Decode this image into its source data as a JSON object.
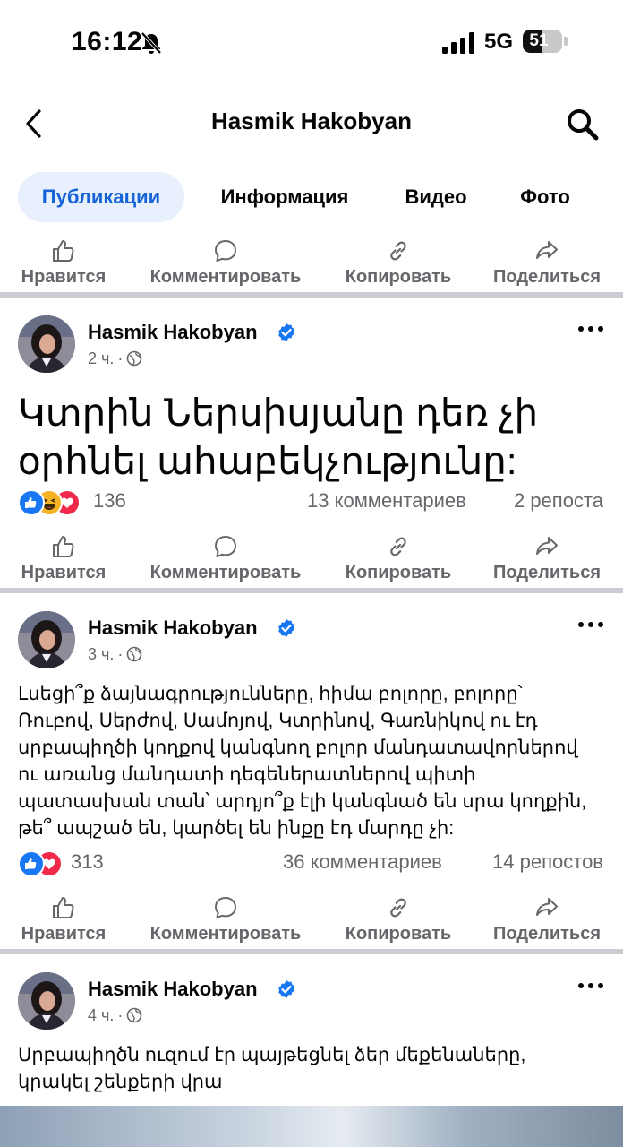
{
  "status_bar": {
    "time": "16:12",
    "network": "5G",
    "battery": "51",
    "battery_level": 0.51
  },
  "nav": {
    "title": "Hasmik Hakobyan"
  },
  "tabs": [
    {
      "label": "Публикации",
      "active": true
    },
    {
      "label": "Информация",
      "active": false
    },
    {
      "label": "Видео",
      "active": false
    },
    {
      "label": "Фото",
      "active": false
    }
  ],
  "actions": {
    "like": "Нравится",
    "comment": "Комментировать",
    "copy": "Копировать",
    "share": "Поделиться"
  },
  "posts": [
    {
      "author": "Hasmik Hakobyan",
      "time": "2 ч.",
      "text": "Կտրին Ներսիսյանը դեռ չի օրհնել ահաբեկչությունը:",
      "reactions": [
        "like",
        "haha",
        "love"
      ],
      "reaction_count": "136",
      "comments": "13 комментариев",
      "reposts": "2 репоста"
    },
    {
      "author": "Hasmik Hakobyan",
      "time": "3 ч.",
      "text_lines": [
        "Լսեցի՞ք ձայնագրությունները, հիմա բոլորը, բոլորը՝",
        "Ռուբով, Սերժով, Սամոյով, Կտրինով, Գառնիկով ու էդ",
        "սրբապիղծի կողքով կանգնող բոլոր մանդատավորներով",
        "ու առանց մանդատի դեգեներատներով պիտի",
        "պատասխան տան՝ արդյո՞ք էլի կանգնած են սրա կողքին,",
        "թե՞ ապշած են, կարծել են ինքը էդ մարդը չի:"
      ],
      "reactions": [
        "like",
        "love"
      ],
      "reaction_count": "313",
      "comments": "36 комментариев",
      "reposts": "14 репостов"
    },
    {
      "author": "Hasmik Hakobyan",
      "time": "4 ч.",
      "text_lines": [
        "Սրբապիղծն ուզում էր պայթեցնել ձեր մեքենաները,",
        "կրակել շենքերի վրա"
      ]
    }
  ],
  "colors": {
    "accent": "#1563d6",
    "tab_active_bg": "#e7f0fc",
    "muted": "#65676b",
    "divider": "#c9ccd1",
    "like": "#1877f2",
    "love": "#f02849",
    "haha": "#f7b125"
  }
}
